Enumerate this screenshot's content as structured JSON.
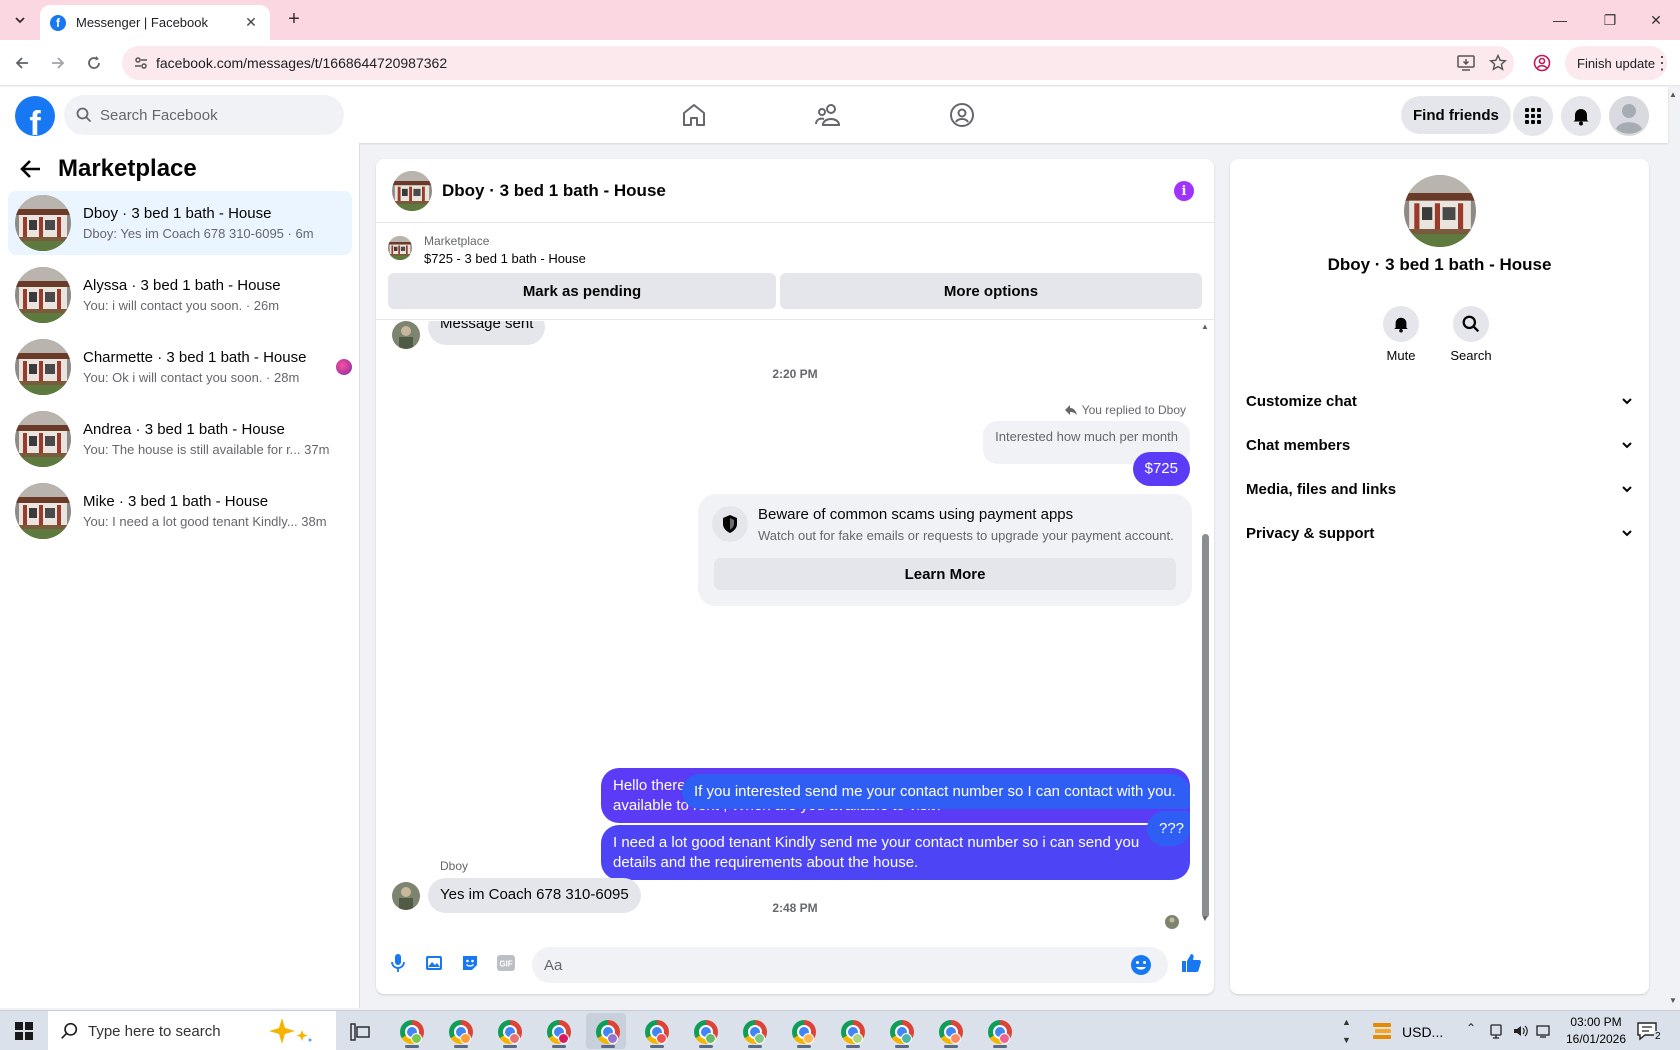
{
  "browser": {
    "tab_title": "Messenger | Facebook",
    "url": "facebook.com/messages/t/1668644720987362",
    "finish_update": "Finish update"
  },
  "header": {
    "search_placeholder": "Search Facebook",
    "find_friends": "Find friends"
  },
  "sidebar": {
    "title": "Marketplace",
    "conversations": [
      {
        "name": "Dboy · 3 bed 1 bath - House",
        "preview": "Dboy: Yes im Coach 678 310-6095 · 6m",
        "active": true
      },
      {
        "name": "Alyssa · 3 bed 1 bath - House",
        "preview": "You: i will contact you soon. · 26m",
        "active": false
      },
      {
        "name": "Charmette · 3 bed 1 bath - House",
        "preview": "You: Ok i will contact you soon. · 28m",
        "active": false
      },
      {
        "name": "Andrea · 3 bed 1 bath - House",
        "preview": "You: The house is still available for r...  37m",
        "active": false
      },
      {
        "name": "Mike · 3 bed 1 bath - House",
        "preview": "You: I need a lot good tenant Kindly...  38m",
        "active": false
      }
    ]
  },
  "chat": {
    "title": "Dboy · 3 bed 1 bath - House",
    "marketplace_label": "Marketplace",
    "listing": "$725 - 3 bed 1 bath - House",
    "mark_pending": "Mark as pending",
    "more_options": "More options",
    "partial_message": "Message sent",
    "time1": "2:20 PM",
    "replied_to": "You replied to Dboy",
    "quoted": "Interested  how much per month",
    "reply_price": "$725",
    "warning_title": "Beware of common scams using payment apps",
    "warning_sub": "Watch out for fake emails or requests to upgrade your payment account.",
    "learn_more": "Learn More",
    "msg1": "Hello there! I'm the house owner. Thanks for your interest, Yes, the house is still available to rent , When are you available to visit?",
    "msg2": "I need a lot good tenant Kindly send me your contact number so i can send you details and the requirements about the house.",
    "time2": "2:48 PM",
    "msg3": "If you interested send me your contact number so I can contact with you.",
    "msg4": "???",
    "sender": "Dboy",
    "incoming": "Yes im Coach 678 310-6095",
    "composer_placeholder": "Aa"
  },
  "details": {
    "name": "Dboy · 3 bed 1 bath - House",
    "mute": "Mute",
    "search": "Search",
    "rows": [
      "Customize chat",
      "Chat members",
      "Media, files and links",
      "Privacy & support"
    ]
  },
  "taskbar": {
    "search_placeholder": "Type here to search",
    "currency": "USD...",
    "time": "03:00 PM",
    "date": "16/01/2026",
    "notif_count": "2"
  },
  "colors": {
    "accent": "#5b3bf6",
    "fb_blue": "#1877f2",
    "tab_strip": "#fad7e1"
  }
}
